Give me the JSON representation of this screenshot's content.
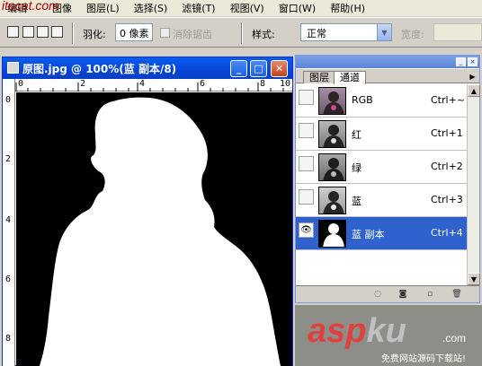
{
  "menubar": {
    "logo": "itocat.com",
    "items": [
      "编辑",
      "图像",
      "图层(L)",
      "选择(S)",
      "滤镜(T)",
      "视图(V)",
      "窗口(W)",
      "帮助(H)"
    ]
  },
  "options": {
    "feather_label": "羽化:",
    "feather_value": "0 像素",
    "antialias_label": "消除锯齿",
    "style_label": "样式:",
    "style_value": "正常",
    "width_label": "宽度:"
  },
  "document": {
    "title": "原图.jpg @ 100%(蓝 副本/8)",
    "ruler_h": [
      "0",
      "2",
      "4",
      "6",
      "8",
      "10"
    ],
    "ruler_v": [
      "0",
      "2",
      "4",
      "6",
      "8"
    ]
  },
  "panel": {
    "tabs": [
      "图层",
      "通道"
    ],
    "active_tab": "通道",
    "channels": [
      {
        "name": "RGB",
        "shortcut": "Ctrl+~",
        "visible": false,
        "selected": false
      },
      {
        "name": "红",
        "shortcut": "Ctrl+1",
        "visible": false,
        "selected": false
      },
      {
        "name": "绿",
        "shortcut": "Ctrl+2",
        "visible": false,
        "selected": false
      },
      {
        "name": "蓝",
        "shortcut": "Ctrl+3",
        "visible": false,
        "selected": false
      },
      {
        "name": "蓝 副本",
        "shortcut": "Ctrl+4",
        "visible": true,
        "selected": true
      }
    ]
  },
  "watermark": {
    "brand_a": "asp",
    "brand_b": "ku",
    "brand_c": ".com",
    "tagline": "免费网站源码下载站!"
  },
  "colors": {
    "titlebar": "#0a5ef0",
    "selection": "#2f62cc",
    "canvas": "#000000",
    "subject": "#ffffff"
  }
}
